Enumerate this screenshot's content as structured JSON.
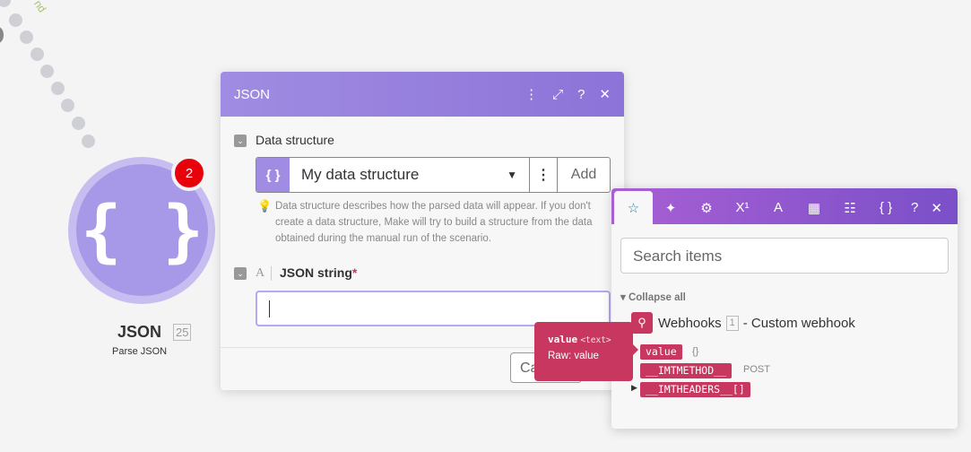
{
  "canvas": {
    "route_label": "nd"
  },
  "node": {
    "title": "JSON",
    "id": "25",
    "subtitle": "Parse JSON",
    "badge": "2",
    "icon": "{ }"
  },
  "dialog": {
    "title": "JSON",
    "header_icons": [
      "more-icon",
      "expand-icon",
      "help-icon",
      "close-icon"
    ],
    "data_structure": {
      "label": "Data structure",
      "value": "My data structure",
      "add_label": "Add",
      "help": "Data structure describes how the parsed data will appear. If you don't create a data structure, Make will try to build a structure from the data obtained during the manual run of the scenario."
    },
    "json_string": {
      "label": "JSON string",
      "required": "*",
      "value": ""
    },
    "cancel_label": "Ca"
  },
  "panel": {
    "tabs": [
      "star",
      "sparkle",
      "gear",
      "superscript",
      "text",
      "calendar",
      "table",
      "braces"
    ],
    "search_placeholder": "Search items",
    "collapse_label": "Collapse all",
    "module": {
      "name": "Webhooks",
      "count": "1",
      "suffix": "- Custom webhook"
    },
    "items": [
      {
        "name": "value",
        "aux": "{}"
      },
      {
        "name": "__IMTMETHOD__",
        "aux": "POST"
      },
      {
        "name": "__IMTHEADERS__[]",
        "aux": ""
      }
    ]
  },
  "tooltip": {
    "name": "value",
    "type": "<text>",
    "raw": "Raw: value"
  },
  "colors": {
    "accent": "#a08ce2",
    "pill": "#c8375f",
    "badge": "#e8000b"
  }
}
